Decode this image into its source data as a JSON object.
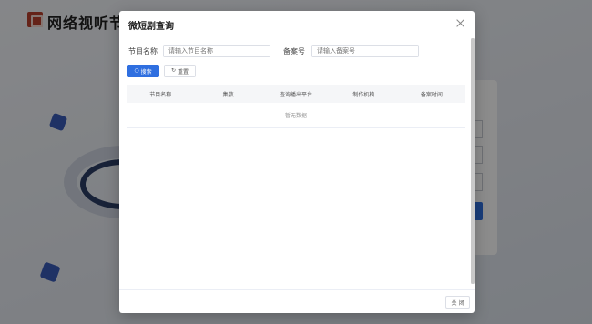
{
  "background": {
    "app_title": "网络视听节目"
  },
  "modal": {
    "title": "微短剧查询",
    "form": {
      "name_label": "节目名称",
      "name_placeholder": "请输入节目名称",
      "record_label": "备案号",
      "record_placeholder": "请输入备案号"
    },
    "buttons": {
      "search": "搜索",
      "reset": "重置",
      "close": "关 闭"
    },
    "table": {
      "columns": [
        "节目名称",
        "集数",
        "查询播出平台",
        "制作机构",
        "备案时间"
      ],
      "empty_text": "暂无数据"
    }
  },
  "colors": {
    "primary": "#2f6fe0",
    "logo": "#b8402e"
  },
  "icons": {
    "search": "search-icon",
    "reset": "refresh-icon",
    "close": "close-icon"
  }
}
